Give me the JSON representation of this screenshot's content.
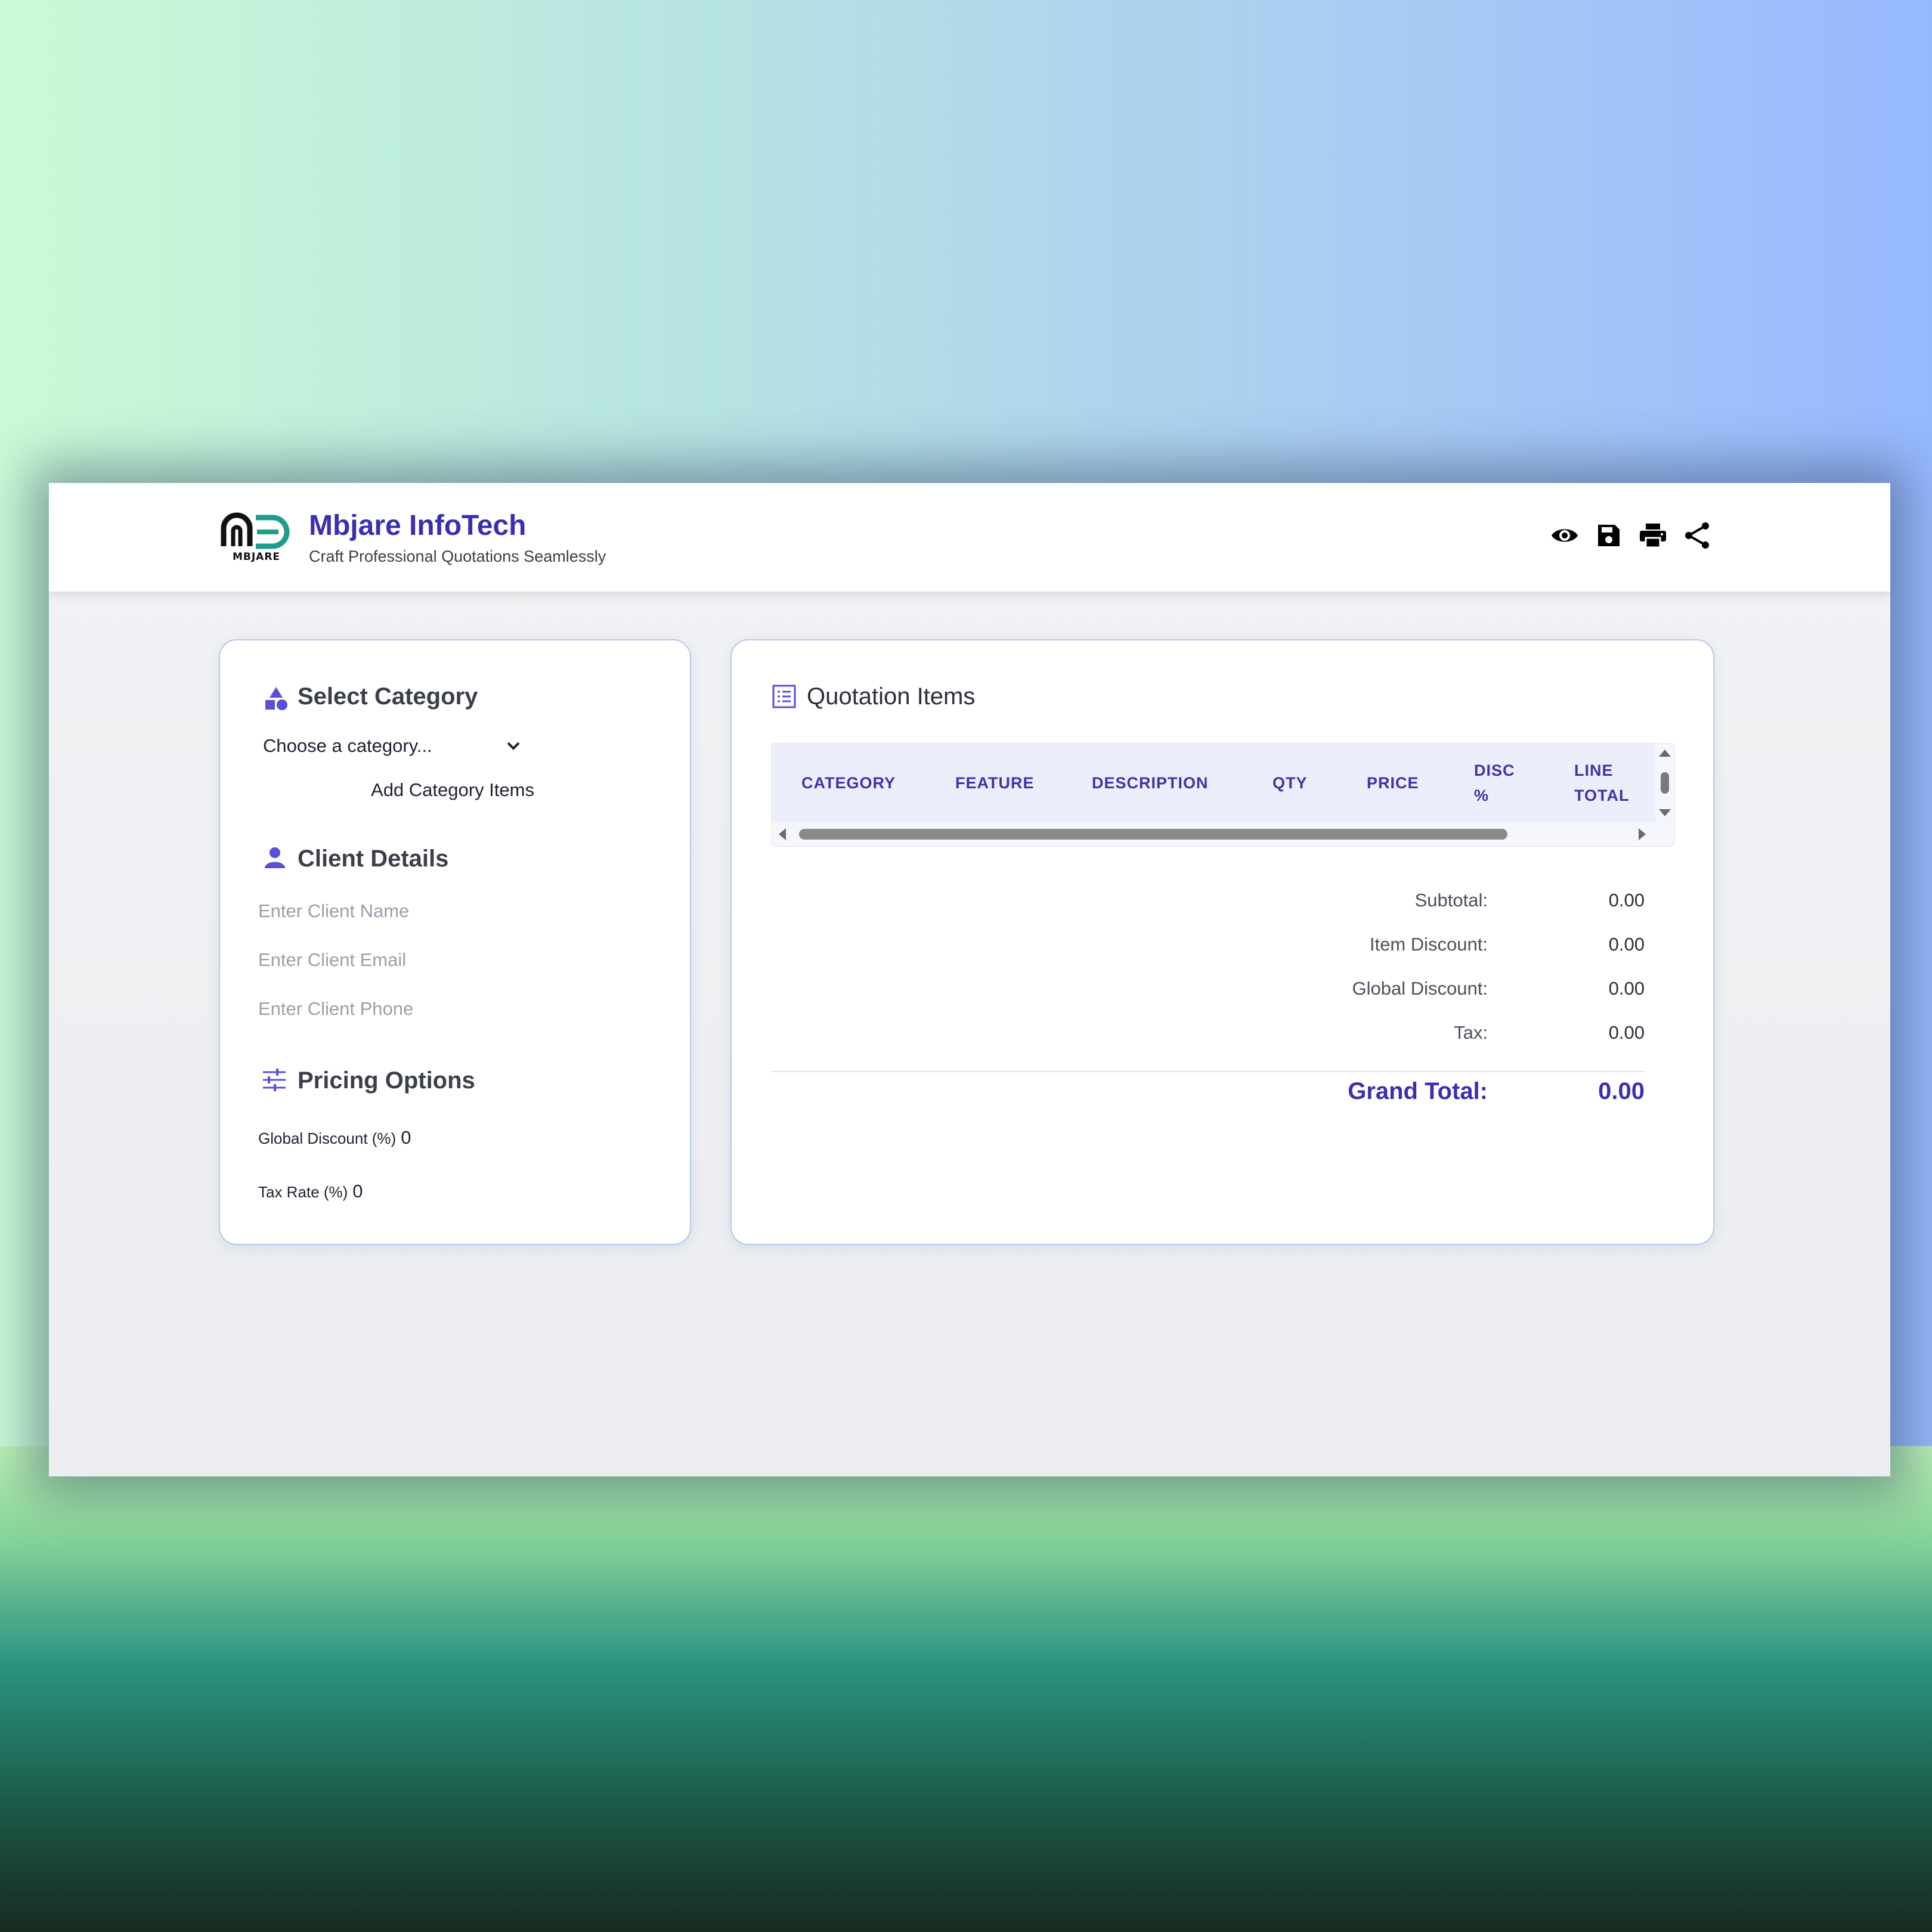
{
  "header": {
    "logo_text": "MBJARE",
    "brand": "Mbjare InfoTech",
    "tagline": "Craft Professional Quotations Seamlessly",
    "actions": [
      "eye-icon",
      "save-icon",
      "print-icon",
      "share-icon"
    ]
  },
  "left": {
    "category_title": "Select Category",
    "category_select_value": "Choose a category...",
    "add_items_label": "Add Category Items",
    "client_title": "Client Details",
    "client_name_placeholder": "Enter Client Name",
    "client_email_placeholder": "Enter Client Email",
    "client_phone_placeholder": "Enter Client Phone",
    "pricing_title": "Pricing Options",
    "global_discount_label": "Global Discount (%)",
    "global_discount_value": "0",
    "tax_rate_label": "Tax Rate (%)",
    "tax_rate_value": "0"
  },
  "right": {
    "title": "Quotation Items",
    "columns": [
      "CATEGORY",
      "FEATURE",
      "DESCRIPTION",
      "QTY",
      "PRICE",
      "DISC %",
      "LINE TOTAL"
    ],
    "totals": [
      {
        "label": "Subtotal:",
        "value": "0.00"
      },
      {
        "label": "Item Discount:",
        "value": "0.00"
      },
      {
        "label": "Global Discount:",
        "value": "0.00"
      },
      {
        "label": "Tax:",
        "value": "0.00"
      }
    ],
    "grand_total_label": "Grand Total:",
    "grand_total_value": "0.00"
  },
  "colors": {
    "accent": "#3a2fb0",
    "icon_accent": "#5a4fd6",
    "header_text": "#3a35a8",
    "card_border": "#b7c8ee"
  }
}
